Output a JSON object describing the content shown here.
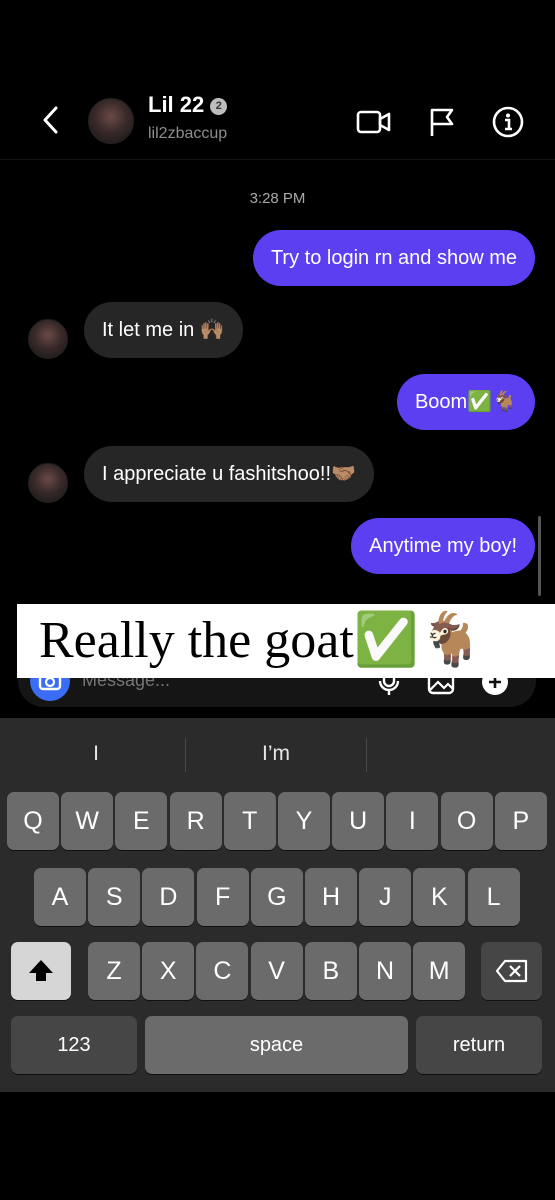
{
  "header": {
    "name": "Lil 22",
    "badge": "2",
    "username": "lil2zbaccup",
    "icons": [
      "back-chevron-icon",
      "video-call-icon",
      "flag-icon",
      "info-icon"
    ]
  },
  "chat": {
    "timestamp": "3:28 PM",
    "messages": [
      {
        "direction": "out",
        "text": "Try to login rn and show me"
      },
      {
        "direction": "in",
        "text": "It let me in 🙌🏽"
      },
      {
        "direction": "out",
        "text": "Boom✅🐐"
      },
      {
        "direction": "in",
        "text": "I appreciate u fashitshoo!!🤝🏽"
      },
      {
        "direction": "out",
        "text": "Anytime my boy!"
      }
    ]
  },
  "composer": {
    "placeholder": "Message...",
    "icons": [
      "camera-icon",
      "microphone-icon",
      "gallery-icon",
      "add-icon"
    ]
  },
  "caption": "Really the goat✅🐐",
  "keyboard": {
    "suggestions": [
      "I",
      "I’m",
      ""
    ],
    "row1": [
      "Q",
      "W",
      "E",
      "R",
      "T",
      "Y",
      "U",
      "I",
      "O",
      "P"
    ],
    "row2": [
      "A",
      "S",
      "D",
      "F",
      "G",
      "H",
      "J",
      "K",
      "L"
    ],
    "row3": [
      "Z",
      "X",
      "C",
      "V",
      "B",
      "N",
      "M"
    ],
    "numbers_label": "123",
    "space_label": "space",
    "return_label": "return"
  },
  "colors": {
    "outgoing_bubble": "#5b3ff0",
    "incoming_bubble": "#262626",
    "camera_button": "#3b6cf5",
    "keyboard_bg": "#2b2b2b"
  }
}
